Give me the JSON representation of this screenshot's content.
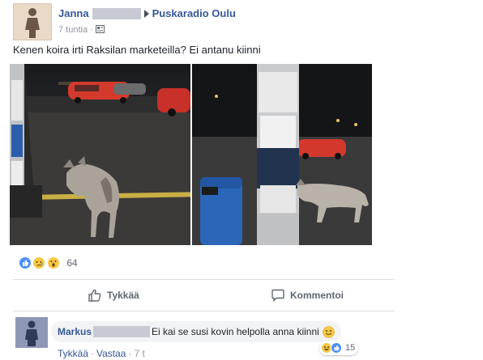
{
  "post": {
    "author": "Janna",
    "group": "Puskaradio Oulu",
    "time": "7 tuntia",
    "meta_separator": "·",
    "text": "Kenen koira irti Raksilan marketeilla? Ei antanu kiinni"
  },
  "reactions": {
    "icons": [
      "like-icon",
      "sad-icon",
      "wow-icon"
    ],
    "count": "64"
  },
  "actions": {
    "like_label": "Tykkää",
    "comment_label": "Kommentoi"
  },
  "comment": {
    "author": "Markus",
    "text": "Ei kai se susi kovin helpolla anna kiinni",
    "reaction_icons": [
      "haha-icon",
      "like-icon"
    ],
    "reaction_count": "15",
    "like_label": "Tykkää",
    "separator": "·",
    "reply_label": "Vastaa",
    "time": "7 t"
  },
  "colors": {
    "link_blue": "#365899",
    "like_blue": "#4d8ef7",
    "grey_text": "#90949c",
    "bubble_bg": "#f2f3f5",
    "redaction": "#c7cad3"
  }
}
